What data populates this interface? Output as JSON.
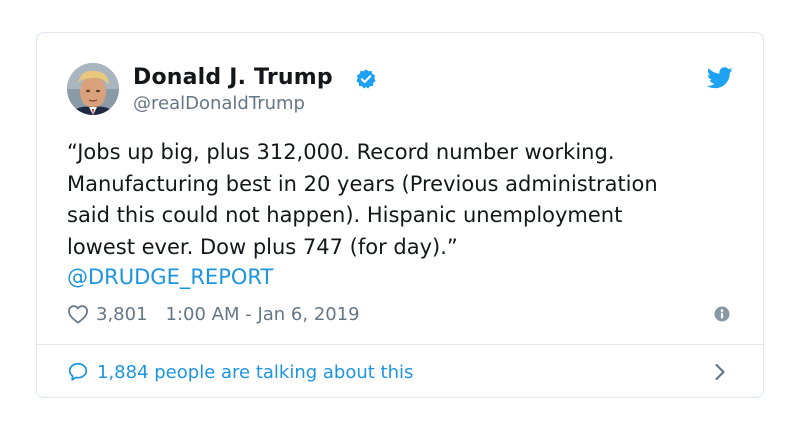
{
  "tweet": {
    "author": {
      "display_name": "Donald J. Trump",
      "handle": "@realDonaldTrump",
      "verified": true,
      "avatar_icon": "profile-photo"
    },
    "text_lines": [
      "“Jobs up big, plus 312,000. Record number working.",
      "Manufacturing best in 20 years (Previous administration",
      "said this could not happen). Hispanic unemployment",
      "lowest ever. Dow plus 747 (for day).”"
    ],
    "mention": "@DRUDGE_REPORT",
    "like_count": "3,801",
    "timestamp": "1:00 AM - Jan 6, 2019",
    "talking_label": "1,884 people are talking about this"
  },
  "icons": {
    "verified": "verified-badge-icon",
    "brand": "twitter-bird-icon",
    "like": "heart-icon",
    "info": "info-icon",
    "conversation": "speech-bubble-icon",
    "more": "chevron-right-icon"
  },
  "colors": {
    "link": "#1b95e0",
    "text": "#14171a",
    "secondary": "#657786",
    "border": "#e1e8ed",
    "verified": "#1da1f2"
  }
}
